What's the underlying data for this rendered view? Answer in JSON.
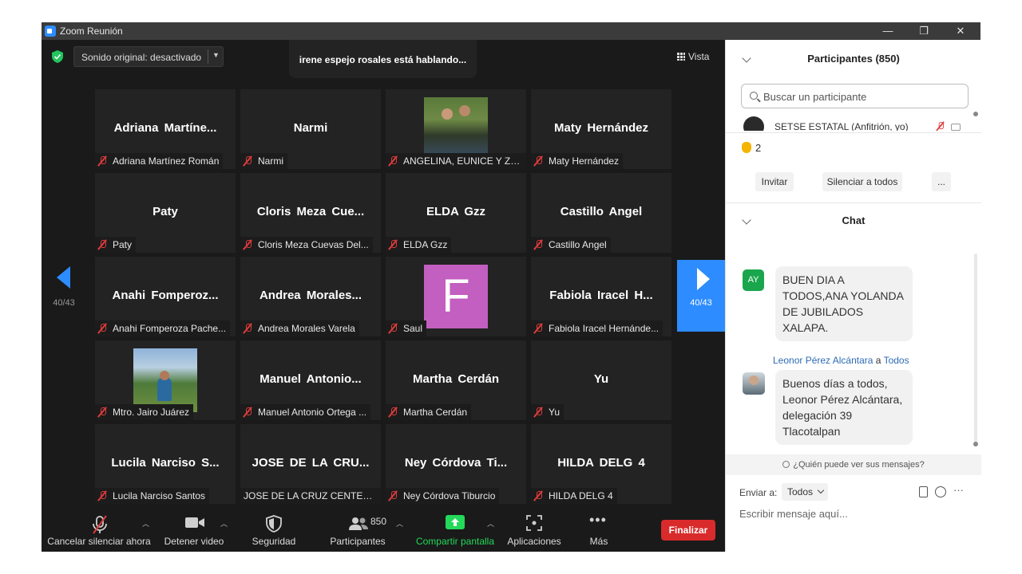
{
  "window": {
    "title": "Zoom Reunión",
    "controls": {
      "minimize": "—",
      "restore": "❐",
      "close": "✕"
    }
  },
  "meeting": {
    "original_sound": "Sonido original: desactivado",
    "speaking": "irene espejo rosales está hablando...",
    "view_label": "Vista",
    "page_left": "40/43",
    "page_right": "40/43"
  },
  "tiles": [
    {
      "big": "Adriana  Martíne...",
      "label": "Adriana Martínez Román",
      "muted": true
    },
    {
      "big": "Narmi",
      "label": "Narmi",
      "muted": true
    },
    {
      "photo": "couple-photo",
      "label": "ANGELINA, EUNICE Y ZA...",
      "muted": true
    },
    {
      "big": "Maty Hernández",
      "label": "Maty Hernández",
      "muted": true
    },
    {
      "big": "Paty",
      "label": "Paty",
      "muted": true
    },
    {
      "big": "Cloris  Meza  Cue...",
      "label": "Cloris Meza Cuevas Del...",
      "muted": true
    },
    {
      "big": "ELDA Gzz",
      "label": "ELDA Gzz",
      "muted": true
    },
    {
      "big": "Castillo Angel",
      "label": "Castillo Angel",
      "muted": true
    },
    {
      "big": "Anahi  Fomperoz...",
      "label": "Anahi Fomperoza Pache...",
      "muted": true
    },
    {
      "big": "Andrea  Morales...",
      "label": "Andrea Morales Varela",
      "muted": true
    },
    {
      "letter": "F",
      "label": "Saul",
      "muted": true
    },
    {
      "big": "Fabiola  Iracel  H...",
      "label": "Fabiola Iracel Hernánde...",
      "muted": true
    },
    {
      "photo": "mountain-photo",
      "label": "Mtro. Jairo Juárez",
      "muted": true
    },
    {
      "big": "Manuel  Antonio...",
      "label": "Manuel Antonio Ortega ...",
      "muted": true
    },
    {
      "big": "Martha Cerdán",
      "label": "Martha Cerdán",
      "muted": true
    },
    {
      "big": "Yu",
      "label": "Yu",
      "muted": true
    },
    {
      "big": "Lucila Narciso S...",
      "label": "Lucila Narciso Santos",
      "muted": true
    },
    {
      "big": "JOSE DE LA CRU...",
      "label": "JOSE DE LA CRUZ CENTENO",
      "muted": false
    },
    {
      "big": "Ney Córdova Ti...",
      "label": "Ney Córdova Tiburcio",
      "muted": true
    },
    {
      "big": "HILDA DELG 4",
      "label": "HILDA DELG 4",
      "muted": true
    }
  ],
  "toolbar": {
    "mute": "Cancelar silenciar ahora",
    "video": "Detener video",
    "security": "Seguridad",
    "participants": "Participantes",
    "participants_count": "850",
    "share": "Compartir pantalla",
    "apps": "Aplicaciones",
    "more": "Más",
    "end": "Finalizar"
  },
  "participants_panel": {
    "title": "Participantes (850)",
    "search_placeholder": "Buscar un participante",
    "host_name": "SETSE ESTATAL (Anfitrión, yo)",
    "raised_hands": "2",
    "invite": "Invitar",
    "mute_all": "Silenciar a todos",
    "more": "..."
  },
  "chat": {
    "title": "Chat",
    "messages": [
      {
        "initials": "AY",
        "text": "BUEN DIA A TODOS,ANA YOLANDA DE JUBILADOS XALAPA."
      },
      {
        "sender": "Leonor Pérez Alcántara",
        "connector": "a",
        "recipient": "Todos",
        "text": "Buenos días a todos, Leonor Pérez Alcántara, delegación 39 Tlacotalpan"
      }
    ],
    "who_can_see": "¿Quién puede ver sus mensajes?",
    "send_to_label": "Enviar a:",
    "send_to_value": "Todos",
    "input_placeholder": "Escribir mensaje aquí..."
  },
  "colors": {
    "accent": "#2d8cff",
    "end_button": "#d92b2b",
    "mute_red": "#e03c3c",
    "share_green": "#23d959",
    "panel_bg": "#ffffff",
    "video_bg": "#1a1a1a"
  }
}
